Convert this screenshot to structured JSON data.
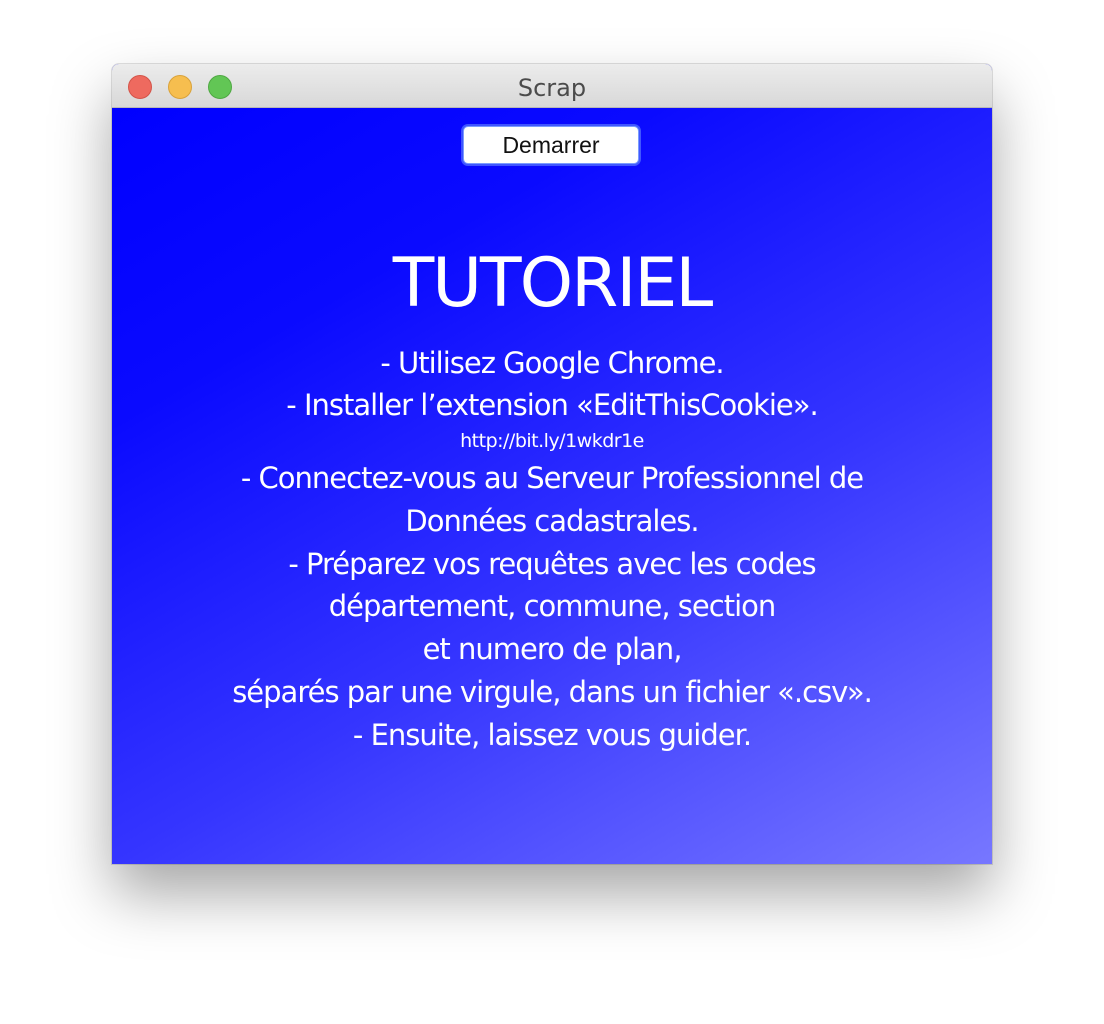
{
  "window": {
    "title": "Scrap"
  },
  "toolbar": {
    "start_label": "Demarrer"
  },
  "tutorial": {
    "title": "TUTORIEL",
    "lines": [
      "- Utilisez Google Chrome.",
      "- Installer l’extension «EditThisCookie».",
      "http://bit.ly/1wkdr1e",
      "- Connectez-vous au Serveur Professionnel de",
      "Données cadastrales.",
      "- Préparez vos requêtes avec les codes",
      "département, commune, section",
      "et numero de plan,",
      "séparés par une virgule, dans un fichier «.csv».",
      "- Ensuite, laissez vous guider."
    ]
  },
  "colors": {
    "background_start": "#0000ff",
    "background_end": "#7777ff",
    "text": "#ffffff"
  }
}
